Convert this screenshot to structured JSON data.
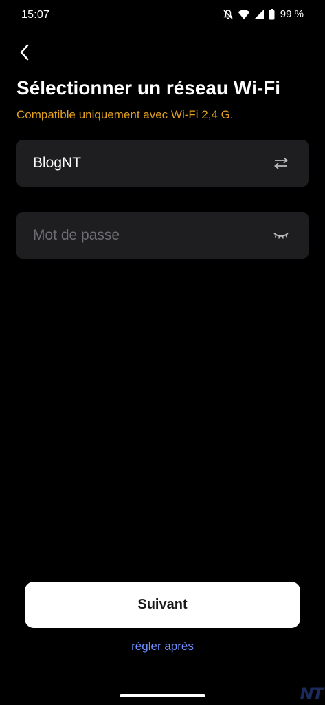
{
  "status_bar": {
    "time": "15:07",
    "battery_percent": "99 %",
    "icons": [
      "notifications-off-icon",
      "wifi-icon",
      "cellular-signal-icon",
      "battery-icon"
    ]
  },
  "header": {
    "back_icon": "chevron-left-icon",
    "title": "Sélectionner un réseau Wi-Fi",
    "subtitle": "Compatible uniquement avec Wi-Fi 2,4 G."
  },
  "form": {
    "network_value": "BlogNT",
    "network_icon": "swap-arrows-icon",
    "password_placeholder": "Mot de passe",
    "password_icon": "eye-closed-icon"
  },
  "actions": {
    "next_label": "Suivant",
    "later_label": "régler après"
  },
  "watermark": "NT",
  "colors": {
    "background": "#000000",
    "field_background": "#1e1e20",
    "subtitle": "#e0a020",
    "link": "#6f8dff",
    "placeholder": "#6e6e72",
    "button_background": "#ffffff",
    "button_text": "#1a1a1a"
  }
}
